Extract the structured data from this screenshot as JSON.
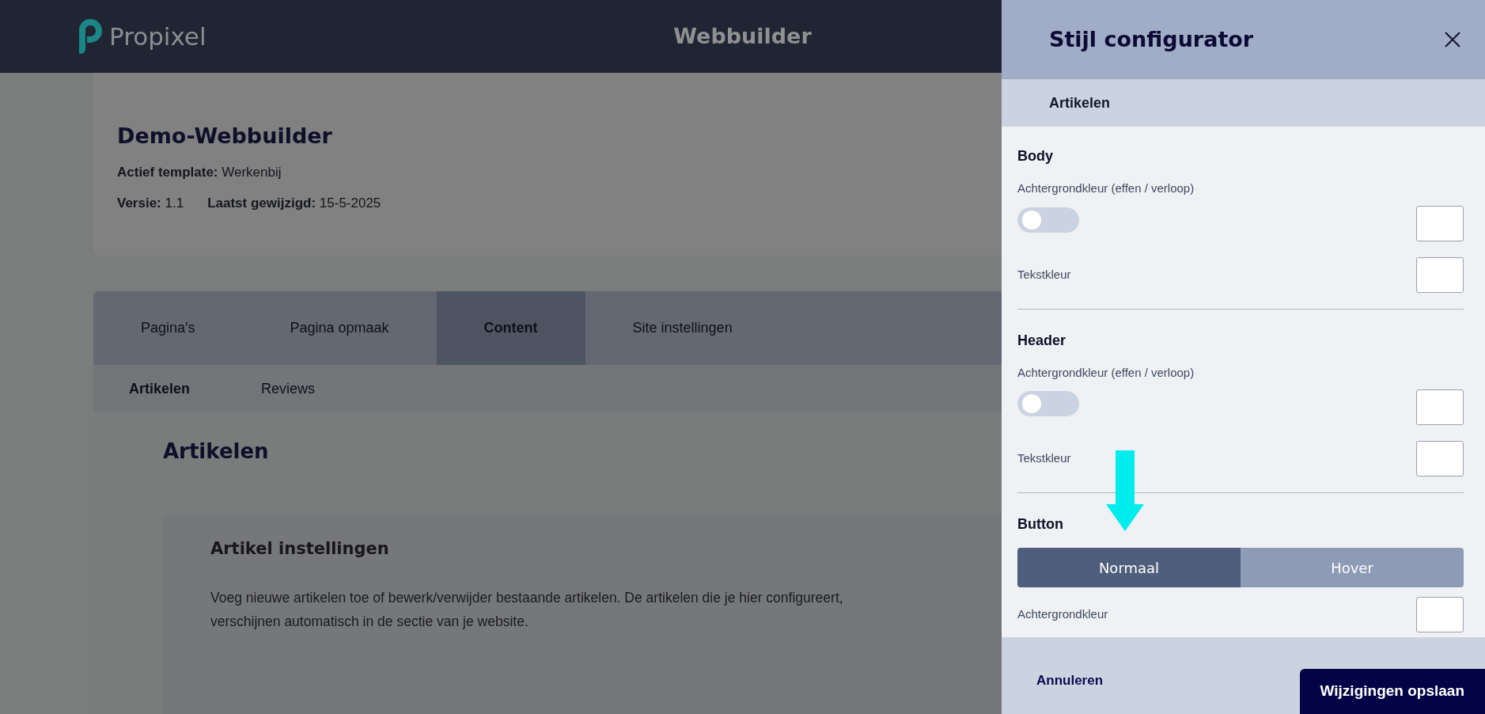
{
  "header": {
    "logo_text": "Propixel",
    "title": "Webbuilder"
  },
  "site": {
    "name": "Demo-Webbuilder",
    "template": "**Actief template:** Werkenbij",
    "version": "**Versie:** 1.1",
    "modified": "**Laatst gewijzigd:** 15-5-2025"
  },
  "tabs": [
    {
      "label": "Pagina's",
      "selected": false
    },
    {
      "label": "Pagina opmaak",
      "selected": false
    },
    {
      "label": "Content",
      "selected": true
    },
    {
      "label": "Site instellingen",
      "selected": false
    }
  ],
  "subtabs": [
    {
      "label": "Artikelen",
      "selected": true
    },
    {
      "label": "Reviews",
      "selected": false
    }
  ],
  "content": {
    "heading": "Artikelen",
    "card_title": "Artikel instellingen",
    "description": "Voeg nieuwe artikelen toe of bewerk/verwijder bestaande artikelen. De artikelen die je hier configureert, verschijnen automatisch in de sectie van je website."
  },
  "panel": {
    "title": "Stijl configurator",
    "section": "Artikelen",
    "groups": [
      {
        "title": "Body",
        "rows": [
          {
            "kind": "gradient",
            "label": "Achtergrondkleur (effen / verloop)",
            "on": false
          },
          {
            "kind": "color",
            "label": "Tekstkleur"
          }
        ]
      },
      {
        "title": "Header",
        "rows": [
          {
            "kind": "gradient",
            "label": "Achtergrondkleur (effen / verloop)",
            "on": false
          },
          {
            "kind": "color",
            "label": "Tekstkleur"
          }
        ]
      },
      {
        "title": "Button",
        "rows": [
          {
            "kind": "segments",
            "options": [
              {
                "label": "Normaal",
                "selected": true
              },
              {
                "label": "Hover",
                "selected": false
              }
            ]
          },
          {
            "kind": "color",
            "label": "Achtergrondkleur"
          }
        ]
      }
    ],
    "cancel": "Annuleren",
    "save": "Wijzigingen opslaan"
  }
}
